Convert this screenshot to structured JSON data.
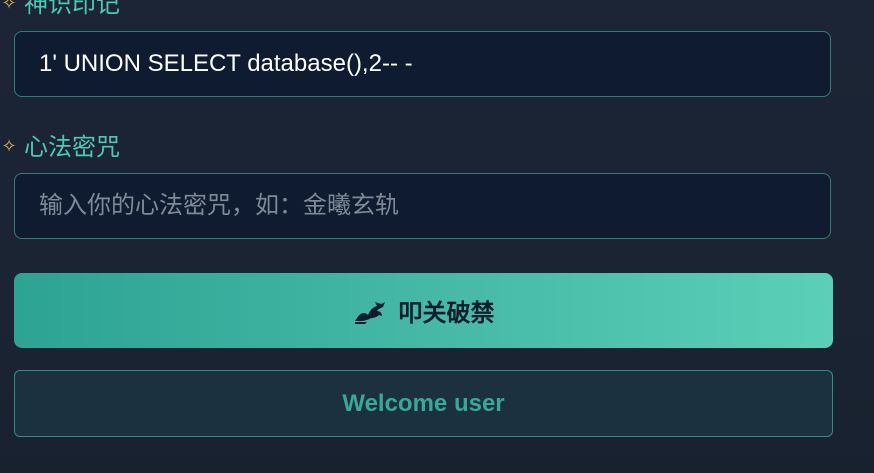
{
  "form": {
    "identity_label": "神识印记",
    "identity_value": "1' UNION SELECT database(),2-- -",
    "password_label": "心法密咒",
    "password_placeholder": "输入你的心法密咒，如：金曦玄轨",
    "label_icon": "sparkle-icon",
    "submit_label": "叩关破禁",
    "submit_icon": "dragon-icon"
  },
  "result": {
    "message": "Welcome user"
  },
  "colors": {
    "background": "#1b2535",
    "label": "#4fc8b2",
    "label_icon": "#d9b04a",
    "input_background": "#0e1b31",
    "input_border": "#2f7f78",
    "button_gradient_start": "#2da394",
    "button_gradient_end": "#5ccfb8",
    "message_text": "#37a994",
    "message_background": "#1c3140"
  }
}
